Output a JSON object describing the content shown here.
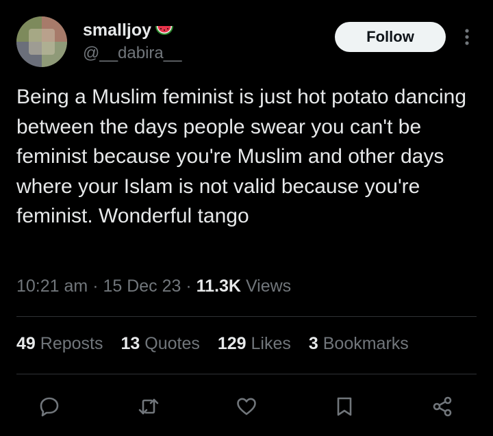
{
  "author": {
    "display_name": "smalljoy",
    "display_name_emoji": "watermelon-icon",
    "handle": "@__dabira__",
    "avatar": "avatar-collage"
  },
  "follow_button": {
    "label": "Follow"
  },
  "tweet": {
    "text": "Being a Muslim feminist is just hot potato dancing between the days people swear you can't be feminist because you're Muslim and other days where your Islam is not valid because you're feminist. Wonderful tango"
  },
  "meta": {
    "time": "10:21 am",
    "sep1": " · ",
    "date": "15 Dec 23",
    "sep2": " · ",
    "views_count": "11.3K",
    "views_label": " Views"
  },
  "stats": {
    "reposts": {
      "count": "49",
      "label": " Reposts"
    },
    "quotes": {
      "count": "13",
      "label": " Quotes"
    },
    "likes": {
      "count": "129",
      "label": " Likes"
    },
    "bookmarks": {
      "count": "3",
      "label": " Bookmarks"
    }
  },
  "actions": [
    "reply-icon",
    "repost-icon",
    "like-icon",
    "bookmark-icon",
    "share-icon"
  ],
  "colors": {
    "background": "#000000",
    "text_primary": "#e7e9ea",
    "text_secondary": "#71767b",
    "divider": "#2f3336",
    "follow_bg": "#eff3f4",
    "follow_text": "#0f1419"
  }
}
